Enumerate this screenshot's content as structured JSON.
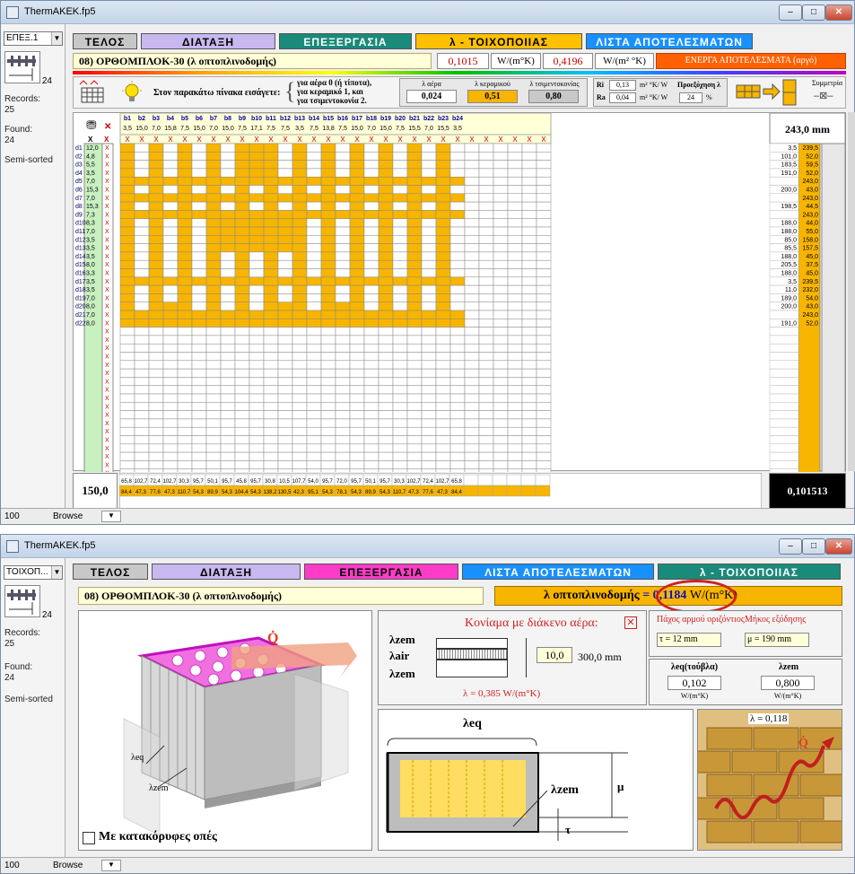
{
  "top": {
    "app_title": "ThermAKEK.fp5",
    "layout_select": "ΕΠΕΞ.1",
    "records_label": "Records:",
    "records_value": "25",
    "found_label": "Found:",
    "found_value": "24",
    "sort_status": "Semi-sorted",
    "book_page": "24",
    "tabs": [
      "ΤΕΛΟΣ",
      "ΔΙΑΤΑΞΗ",
      "ΕΠΕΞΕΡΓΑΣΙΑ",
      "λ - ΤΟΙΧΟΠΟΙΙΑΣ",
      "ΛΙΣΤΑ ΑΠΟΤΕΛΕΣΜΑΤΩΝ"
    ],
    "record_title": "08) ΟΡΘΟΜΠΛΟΚ-30 (λ οπτοπλινοδομής)",
    "value1": "0,1015",
    "unit1": "W/(m°K)",
    "value2": "0,4196",
    "unit2": "W/(m² °K)",
    "energy_label": "ΕΝΕΡΓΑ ΑΠΟΤΕΛΕΣΜΑΤΑ (αργό)",
    "hint_text": "Στον παρακάτω πίνακα εισάγετε:",
    "hint_options": [
      "για αέρα 0 (ή τίποτα),",
      "για κεραμικό 1, και",
      "για τσιμεντοκονία 2."
    ],
    "lambda_labels": [
      "λ αέρα",
      "λ κεραμικού",
      "λ τσιμεντοκονίας"
    ],
    "lambda_values": [
      "0,024",
      "0,51",
      "0,80"
    ],
    "ri_label": "Ri",
    "ri_value": "0,13",
    "ri_unit": "m² °K/ W",
    "ra_label": "Ra",
    "ra_value": "0,04",
    "ra_unit": "m² °K/ W",
    "proj_label": "Προεξόχηση λ",
    "proj_value": "24",
    "proj_unit": "%",
    "sym_label": "Συμμετρία",
    "col_heads": [
      "b1",
      "b2",
      "b3",
      "b4",
      "b5",
      "b6",
      "b7",
      "b8",
      "b9",
      "b10",
      "b11",
      "b12",
      "b13",
      "b14",
      "b15",
      "b16",
      "b17",
      "b18",
      "b19",
      "b20",
      "b21",
      "b22",
      "b23",
      "b24"
    ],
    "col_widths": [
      "3,5",
      "15,0",
      "7,0",
      "15,8",
      "7,5",
      "15,0",
      "7,0",
      "15,0",
      "7,5",
      "17,1",
      "7,5",
      "7,5",
      "3,5",
      "7,5",
      "13,8",
      "7,5",
      "15,0",
      "7,0",
      "15,0",
      "7,5",
      "15,5",
      "7,0",
      "15,5",
      "3,5"
    ],
    "x_mark": "X",
    "row_heads": [
      "d1",
      "d2",
      "d3",
      "d4",
      "d5",
      "d6",
      "d7",
      "d8",
      "d9",
      "d10",
      "d11",
      "d12",
      "d13",
      "d14",
      "d15",
      "d16",
      "d17",
      "d18",
      "d19",
      "d20",
      "d21",
      "d22"
    ],
    "row_heights": [
      "12,0",
      "4,8",
      "5,5",
      "3,5",
      "7,0",
      "15,3",
      "7,0",
      "15,3",
      "7,3",
      "8,3",
      "7,0",
      "3,5",
      "3,5",
      "3,5",
      "8,0",
      "3,3",
      "3,5",
      "3,5",
      "7,0",
      "8,0",
      "7,0",
      "8,0"
    ],
    "right_head": "243,0 mm",
    "right_a": [
      "3,5",
      "101,0",
      "183,5",
      "191,0",
      "",
      "200,0",
      "",
      "198,5",
      "",
      "188,0",
      "188,0",
      "85,0",
      "85,5",
      "188,0",
      "205,5",
      "188,0",
      "3,5",
      "11,0",
      "189,0",
      "200,0",
      "",
      "191,0"
    ],
    "right_b": [
      "239,5",
      "52,0",
      "59,5",
      "52,0",
      "243,0",
      "43,0",
      "243,0",
      "44,5",
      "243,0",
      "44,0",
      "55,0",
      "158,0",
      "157,5",
      "45,0",
      "37,5",
      "45,0",
      "239,5",
      "232,0",
      "54,0",
      "43,0",
      "243,0",
      "52,0"
    ],
    "bottom_left": "150,0",
    "bottom_row1": [
      "65,8",
      "102,7",
      "72,4",
      "102,7",
      "30,3",
      "95,7",
      "50,1",
      "95,7",
      "45,8",
      "95,7",
      "30,8",
      "10,5",
      "107,7",
      "54,0",
      "95,7",
      "72,0",
      "95,7",
      "50,1",
      "95,7",
      "30,3",
      "102,7",
      "72,4",
      "102,7",
      "65,8"
    ],
    "bottom_row2": [
      "84,4",
      "47,3",
      "77,6",
      "47,3",
      "110,7",
      "54,3",
      "89,9",
      "54,3",
      "104,4",
      "54,3",
      "138,2",
      "130,5",
      "42,3",
      "95,1",
      "54,3",
      "78,1",
      "54,3",
      "89,9",
      "54,3",
      "110,7",
      "47,3",
      "77,6",
      "47,3",
      "84,4"
    ],
    "result": "0,101513",
    "zoom": "100",
    "mode": "Browse"
  },
  "bottom": {
    "app_title": "ThermAKEK.fp5",
    "layout_select": "ΤΟΙΧΟΠ...",
    "records_label": "Records:",
    "records_value": "25",
    "found_label": "Found:",
    "found_value": "24",
    "sort_status": "Semi-sorted",
    "book_page": "24",
    "tabs": [
      "ΤΕΛΟΣ",
      "ΔΙΑΤΑΞΗ",
      "ΕΠΕΞΕΡΓΑΣΙΑ",
      "ΛΙΣΤΑ ΑΠΟΤΕΛΕΣΜΑΤΩΝ",
      "λ - ΤΟΙΧΟΠΟΙΙΑΣ"
    ],
    "record_title": "08) ΟΡΘΟΜΠΛΟΚ-30 (λ οπτοπλινοδομής)",
    "lambda_result_label": "λ οπτοπλινοδομής",
    "lambda_result_value": "= 0,1184",
    "lambda_result_unit": "W/(m°K)",
    "mortar_title": "Κονίαμα με διάκενο αέρα:",
    "lz1": "λzem",
    "lair": "λair",
    "lz2": "λzem",
    "air_gap": "10,0",
    "wall_mm": "300,0 mm",
    "mortar_lambda": "λ = 0,385 W/(m°K)",
    "joint_label": "Πάχος αρμού οριζόντιος",
    "joint_value": "τ = 12 mm",
    "length_label": "Μήκος εξόδησης",
    "length_value": "μ = 190 mm",
    "leq_label": "λeq(τούβλα)",
    "lzem_label": "λzem",
    "leq_value": "0,102",
    "lzem_value": "0,800",
    "unit_small": "W/(m°K)",
    "diag_leq": "λeq",
    "diag_lzem": "λzem",
    "diag_mu": "μ",
    "diag_tau": "τ",
    "photo_lambda": "λ = 0,118",
    "q_label": "Q̇",
    "checkbox_label": "Με κατακόρυφες οπές",
    "block_leq": "λeq",
    "block_lzem": "λzem",
    "zoom": "100",
    "mode": "Browse"
  },
  "colors": {
    "yellow": "#f7b500",
    "green_tab": "#1a8a7a",
    "purple_tab": "#c8b8f0",
    "orange_tab": "#ffc000",
    "blue_tab": "#1890ff",
    "magenta_tab": "#ff3cc8",
    "red_highlight": "#d02020"
  }
}
